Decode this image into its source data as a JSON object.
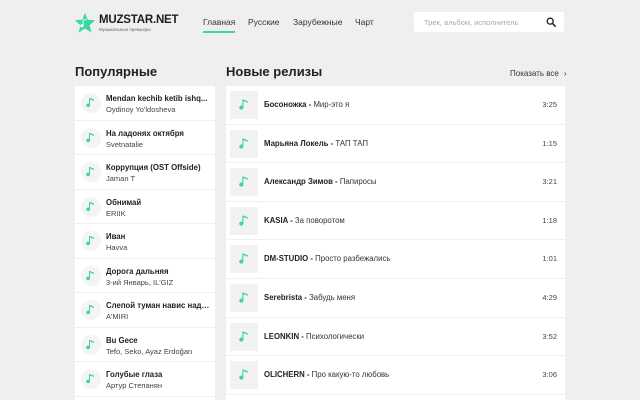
{
  "brand": {
    "title": "MUZSTAR.NET",
    "subtitle": "Музыкальные премьеры",
    "accent": "#3dd6a2"
  },
  "nav": [
    {
      "label": "Главная",
      "active": true
    },
    {
      "label": "Русские",
      "active": false
    },
    {
      "label": "Зарубежные",
      "active": false
    },
    {
      "label": "Чарт",
      "active": false
    }
  ],
  "search": {
    "placeholder": "Трек, альбом, исполнитель",
    "value": ""
  },
  "popular": {
    "title": "Популярные",
    "items": [
      {
        "title": "Mendan kechib ketib ishq...",
        "artist": "Oydinoy Yo'ldosheva"
      },
      {
        "title": "На ладонях октября",
        "artist": "Svetnatalie"
      },
      {
        "title": "Коррупция (OST Offside)",
        "artist": "Jaman T"
      },
      {
        "title": "Обнимай",
        "artist": "ERIIK"
      },
      {
        "title": "Иван",
        "artist": "Havva"
      },
      {
        "title": "Дорога дальняя",
        "artist": "3-ий Январь, IL'GIZ"
      },
      {
        "title": "Слепой туман навис над ...",
        "artist": "A'MIRI"
      },
      {
        "title": "Bu Gece",
        "artist": "Tefo, Seko, Ayaz Erdoğan"
      },
      {
        "title": "Голубые глаза",
        "artist": "Артур Степанян"
      }
    ]
  },
  "releases": {
    "title": "Новые релизы",
    "show_all": "Показать все",
    "items": [
      {
        "artist": "Босоножка",
        "sep": " - ",
        "track": "Мир-это я",
        "duration": "3:25"
      },
      {
        "artist": "Марьяна Локель",
        "sep": " - ",
        "track": "ТАП ТАП",
        "duration": "1:15"
      },
      {
        "artist": "Александр Зимов",
        "sep": " - ",
        "track": "Папиросы",
        "duration": "3:21"
      },
      {
        "artist": "KASIA",
        "sep": " - ",
        "track": "За поворотом",
        "duration": "1:18"
      },
      {
        "artist": "DM-STUDIO",
        "sep": " - ",
        "track": "Просто разбежались",
        "duration": "1:01"
      },
      {
        "artist": "Serebrista",
        "sep": " - ",
        "track": "Забудь меня",
        "duration": "4:29"
      },
      {
        "artist": "LEONKIN",
        "sep": " - ",
        "track": "Психологически",
        "duration": "3:52"
      },
      {
        "artist": "OLICHERN",
        "sep": " - ",
        "track": "Про какую-то любовь",
        "duration": "3:06"
      }
    ]
  }
}
